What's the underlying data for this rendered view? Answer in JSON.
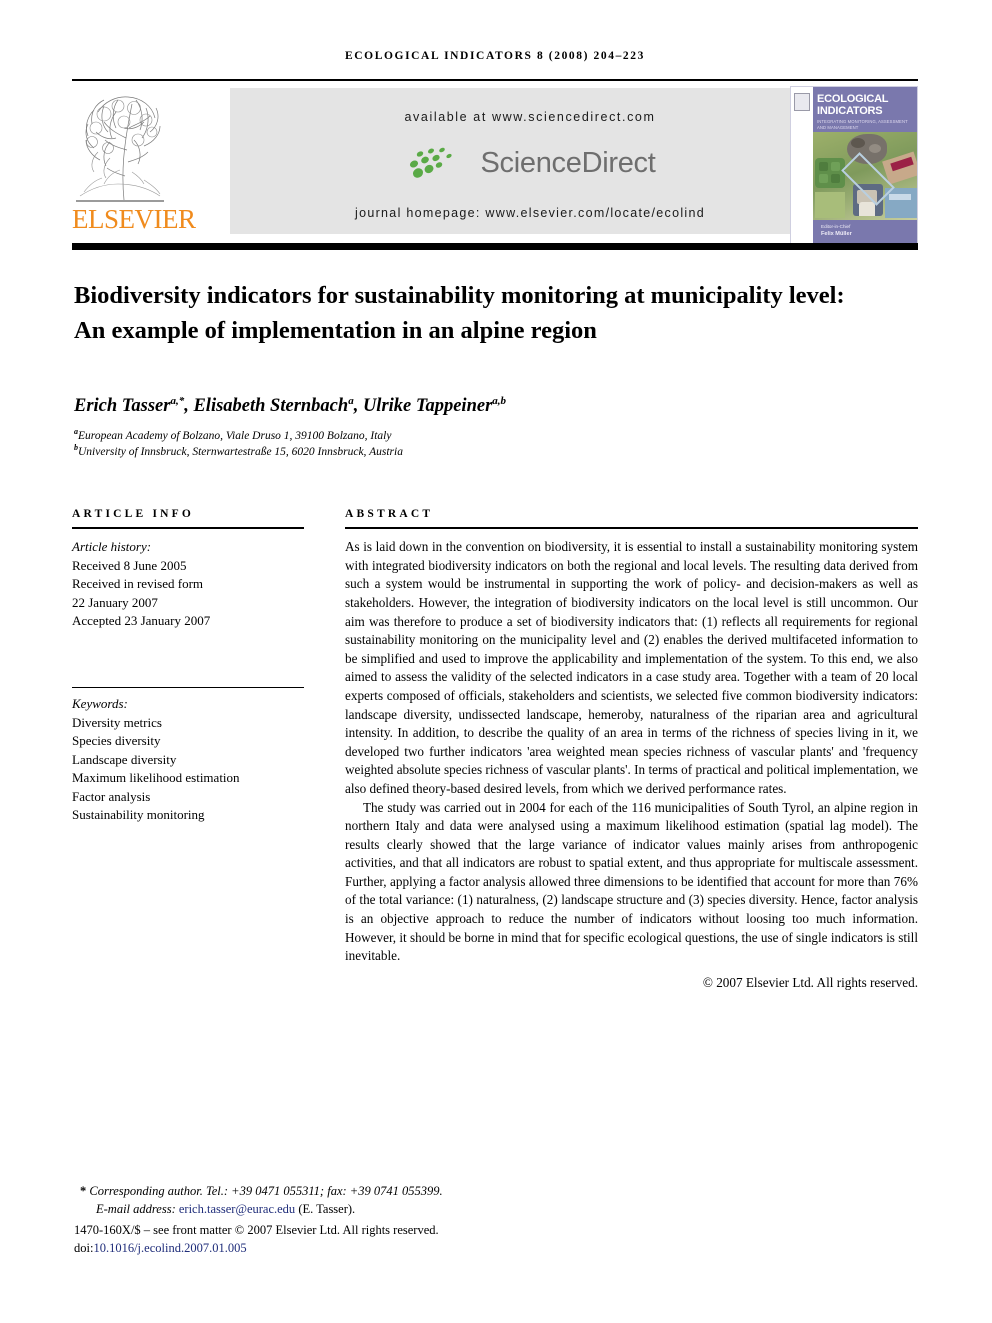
{
  "running_head": "Ecological Indicators 8 (2008) 204–223",
  "masthead": {
    "publisher": "ELSEVIER",
    "available_at": "available at www.sciencedirect.com",
    "sciencedirect_logo_text": "ScienceDirect",
    "journal_homepage": "journal homepage: www.elsevier.com/locate/ecolind",
    "cover": {
      "title_line1": "ECOLOGICAL",
      "title_line2": "INDICATORS",
      "subtitle": "INTEGRATING MONITORING, ASSESSMENT AND MANAGEMENT",
      "editor_label": "Editor-in-Chief",
      "editor_name": "Felix Müller"
    }
  },
  "article": {
    "title": "Biodiversity indicators for sustainability monitoring at municipality level: An example of implementation in an alpine region",
    "authors_html": "Erich Tasser<sup>a,*</sup>, Elisabeth Sternbach<sup>a</sup>, Ulrike Tappeiner<sup>a,b</sup>",
    "affiliation_a": "European Academy of Bolzano, Viale Druso 1, 39100 Bolzano, Italy",
    "affiliation_b": "University of Innsbruck, Sternwartestraße 15, 6020 Innsbruck, Austria"
  },
  "info": {
    "heading": "ARTICLE INFO",
    "history_label": "Article history:",
    "history": [
      "Received 8 June 2005",
      "Received in revised form",
      "22 January 2007",
      "Accepted 23 January 2007"
    ],
    "keywords_label": "Keywords:",
    "keywords": [
      "Diversity metrics",
      "Species diversity",
      "Landscape diversity",
      "Maximum likelihood estimation",
      "Factor analysis",
      "Sustainability monitoring"
    ]
  },
  "abstract": {
    "heading": "ABSTRACT",
    "paragraph1": "As is laid down in the convention on biodiversity, it is essential to install a sustainability monitoring system with integrated biodiversity indicators on both the regional and local levels. The resulting data derived from such a system would be instrumental in supporting the work of policy- and decision-makers as well as stakeholders. However, the integration of biodiversity indicators on the local level is still uncommon. Our aim was therefore to produce a set of biodiversity indicators that: (1) reflects all requirements for regional sustainability monitoring on the municipality level and (2) enables the derived multifaceted information to be simplified and used to improve the applicability and implementation of the system. To this end, we also aimed to assess the validity of the selected indicators in a case study area. Together with a team of 20 local experts composed of officials, stakeholders and scientists, we selected five common biodiversity indicators: landscape diversity, undissected landscape, hemeroby, naturalness of the riparian area and agricultural intensity. In addition, to describe the quality of an area in terms of the richness of species living in it, we developed two further indicators 'area weighted mean species richness of vascular plants' and 'frequency weighted absolute species richness of vascular plants'. In terms of practical and political implementation, we also defined theory-based desired levels, from which we derived performance rates.",
    "paragraph2": "The study was carried out in 2004 for each of the 116 municipalities of South Tyrol, an alpine region in northern Italy and data were analysed using a maximum likelihood estimation (spatial lag model). The results clearly showed that the large variance of indicator values mainly arises from anthropogenic activities, and that all indicators are robust to spatial extent, and thus appropriate for multiscale assessment. Further, applying a factor analysis allowed three dimensions to be identified that account for more than 76% of the total variance: (1) naturalness, (2) landscape structure and (3) species diversity. Hence, factor analysis is an objective approach to reduce the number of indicators without loosing too much information. However, it should be borne in mind that for specific ecological questions, the use of single indicators is still inevitable.",
    "copyright": "© 2007 Elsevier Ltd. All rights reserved."
  },
  "footer": {
    "corresponding_marker": "*",
    "corresponding": "Corresponding author. Tel.: +39 0471 055311; fax: +39 0741 055399.",
    "email_label": "E-mail address:",
    "email": "erich.tasser@eurac.edu",
    "email_suffix": "(E. Tasser).",
    "issn_line": "1470-160X/$ – see front matter © 2007 Elsevier Ltd. All rights reserved.",
    "doi_label": "doi:",
    "doi": "10.1016/j.ecolind.2007.01.005"
  },
  "colors": {
    "elsevier_orange": "#F08B1D",
    "banner_gray": "#e4e4e4",
    "sciencedirect_green": "#5aaa46",
    "sciencedirect_gray": "#6e6e6e",
    "cover_purple": "#7a78ad",
    "link_blue": "#1f2d7a"
  }
}
